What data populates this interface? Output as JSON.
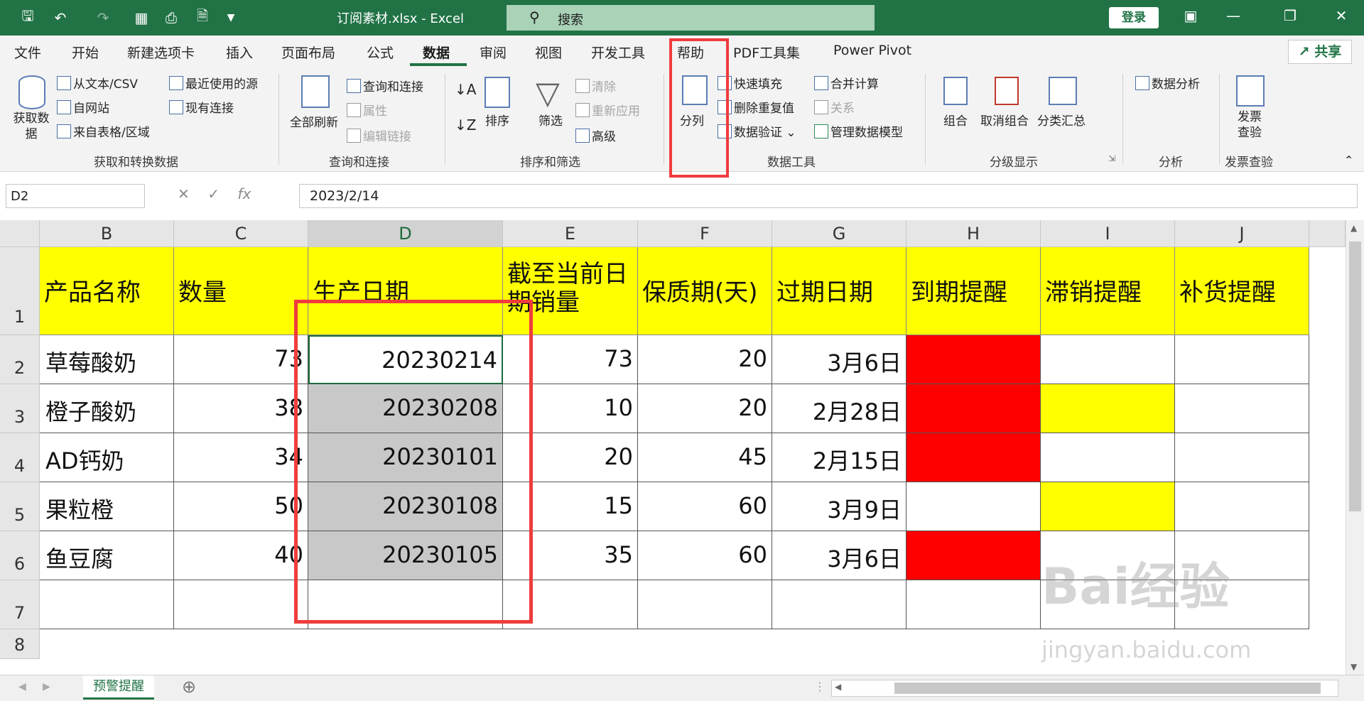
{
  "title_bar": {
    "doc_title": "订阅素材.xlsx  -  Excel",
    "search_placeholder": "搜索",
    "login_label": "登录"
  },
  "tabs": [
    "文件",
    "开始",
    "新建选项卡",
    "插入",
    "页面布局",
    "公式",
    "数据",
    "审阅",
    "视图",
    "开发工具",
    "帮助",
    "PDF工具集",
    "Power Pivot"
  ],
  "active_tab": "数据",
  "share_label": "共享",
  "ribbon": {
    "get_data": {
      "big": "获取数据",
      "items": [
        "从文本/CSV",
        "自网站",
        "来自表格/区域",
        "最近使用的源",
        "现有连接"
      ],
      "group": "获取和转换数据"
    },
    "queries": {
      "big": "全部刷新",
      "items": [
        "查询和连接",
        "属性",
        "编辑链接"
      ],
      "group": "查询和连接"
    },
    "sort": {
      "sort_label": "排序",
      "filter_label": "筛选",
      "items": [
        "清除",
        "重新应用",
        "高级"
      ],
      "group": "排序和筛选"
    },
    "data_tools": {
      "split_label": "分列",
      "items": [
        "快速填充",
        "删除重复值",
        "数据验证",
        "合并计算",
        "关系",
        "管理数据模型"
      ],
      "group": "数据工具"
    },
    "outline": {
      "items": [
        "组合",
        "取消组合",
        "分类汇总"
      ],
      "group": "分级显示"
    },
    "analysis": {
      "item": "数据分析",
      "group": "分析"
    },
    "invoice": {
      "item": "发票查验",
      "group": "发票查验"
    }
  },
  "formula_bar": {
    "name_box": "D2",
    "formula": "2023/2/14"
  },
  "columns": [
    "B",
    "C",
    "D",
    "E",
    "F",
    "G",
    "H",
    "I",
    "J"
  ],
  "rows": [
    "1",
    "2",
    "3",
    "4",
    "5",
    "6",
    "7",
    "8"
  ],
  "header_row": [
    "产品名称",
    "数量",
    "生产日期",
    "截至当前日期销量",
    "保质期(天)",
    "过期日期",
    "到期提醒",
    "滞销提醒",
    "补货提醒"
  ],
  "data_rows": [
    [
      "草莓酸奶",
      "73",
      "20230214",
      "73",
      "20",
      "3月6日"
    ],
    [
      "橙子酸奶",
      "38",
      "20230208",
      "10",
      "20",
      "2月28日"
    ],
    [
      "AD钙奶",
      "34",
      "20230101",
      "20",
      "45",
      "2月15日"
    ],
    [
      "果粒橙",
      "50",
      "20230108",
      "15",
      "60",
      "3月9日"
    ],
    [
      "鱼豆腐",
      "40",
      "20230105",
      "35",
      "60",
      "3月6日"
    ]
  ],
  "sheet_tab": "预警提醒",
  "watermark": "Bai经验",
  "watermark_url": "jingyan.baidu.com",
  "colors": {
    "excel_green": "#217346",
    "highlight_red": "#f03c3c",
    "alert_red": "#ff0000",
    "alert_yellow": "#ffff00"
  }
}
